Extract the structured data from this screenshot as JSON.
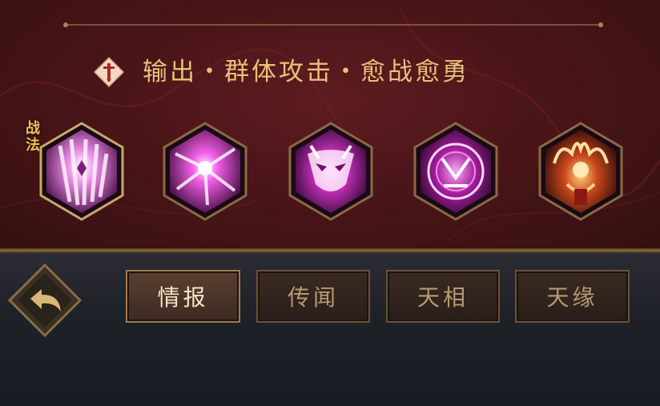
{
  "hero_info": {
    "role_text": "输出・群体攻击・愈战愈勇",
    "role_icon": "sword-emblem-icon",
    "badge_label": "战法",
    "skills": [
      {
        "icon": "crystal-claw-skill-icon"
      },
      {
        "icon": "burst-slash-skill-icon"
      },
      {
        "icon": "demon-mask-skill-icon"
      },
      {
        "icon": "rune-circle-skill-icon"
      },
      {
        "icon": "flame-demon-skill-icon"
      }
    ]
  },
  "nav": {
    "back_icon": "back-arrow-icon",
    "tabs": [
      {
        "label": "情报",
        "active": true
      },
      {
        "label": "传闻",
        "active": false
      },
      {
        "label": "天相",
        "active": false
      },
      {
        "label": "天缘",
        "active": false
      }
    ]
  },
  "colors": {
    "accent_gold": "#e8c27a",
    "panel_red": "#4a1518",
    "skill_magenta": "#d640c9"
  }
}
